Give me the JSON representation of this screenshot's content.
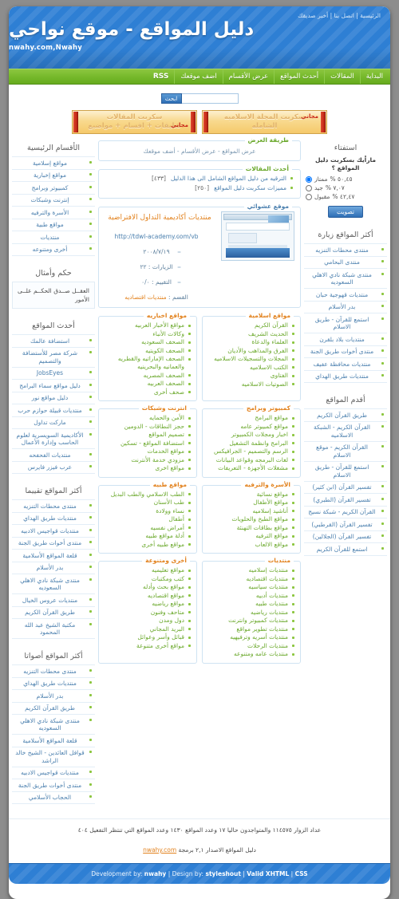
{
  "header": {
    "title": "دليل المواقع - موقع نواحي",
    "subtitle": "nwahy.com,Nwahy",
    "toplinks": [
      "الرئيسية",
      "اتصل بنا",
      "أخبر صديقك"
    ],
    "separator": " | "
  },
  "nav": {
    "items": [
      "البداية",
      "المقالات",
      "أحدث المواقع",
      "عرض الأقسام",
      "اضف موقعك",
      "RSS"
    ]
  },
  "search": {
    "value": "",
    "placeholder": "",
    "button": "ابحث"
  },
  "banners": [
    {
      "line1": "سكربت المجلة الاسلاميه",
      "line2": "الشامله",
      "free": "مجاني"
    },
    {
      "line1": "سكربت المقالات",
      "line2": "تعليقات + اقسام + مواضيع",
      "free": "مجاني"
    }
  ],
  "view_panel": {
    "legend": "طريقة العرض",
    "links": [
      "عرض المواقع",
      "عرض الأقسام",
      "أضف موقعك"
    ],
    "joiner": " - "
  },
  "articles_panel": {
    "legend": "أحدث المقالات",
    "items": [
      {
        "title": "الترقيه من دليل المواقع الشامل الى هذا الدليل",
        "count": "[٤٣٣]"
      },
      {
        "title": "مميزات سكربت دليل المواقع",
        "count": "[٢٥٠]"
      }
    ]
  },
  "random_panel": {
    "legend": "موقع عشوائي",
    "title": "منتديات أكاديمية التداول الافتراضية",
    "url": "http://tdwl-academy.com/vb",
    "date": "٢٠٠٨/٧/١٩",
    "visits_label": "الزيارات",
    "visits": "٢٢",
    "rating_label": "التقييم",
    "rating": "٠/٠",
    "cat_label": "القسم",
    "category": "منتديات اقتصاديه"
  },
  "categories": [
    {
      "legend": "مواقع اسلامية",
      "items": [
        "القرآن الكريم",
        "الحديث الشريف",
        "العلماء والدعاة",
        "الفرق والمذاهب والأديان",
        "المجلات والتسجيلات الاسلاميه",
        "الكتب الاسلاميه",
        "الفتاوى",
        "الصوتيات الاسلاميه"
      ]
    },
    {
      "legend": "مواقع اخباريه",
      "items": [
        "مواقع الأخبار العربيه",
        "وكالات الأنباء",
        "الصحف السعوديه",
        "الصحف الكويتيه",
        "الصحف الإماراتيه والقطريه والعمانيه والبحرينيه",
        "الصحف المصريه",
        "الصحف العربيه",
        "صحف أخرى"
      ]
    },
    {
      "legend": "كمبيوتر وبرامج",
      "items": [
        "مواقع البرامج",
        "مواقع كمبيوتر عامه",
        "اخبار ومجلات الكمبيوتر",
        "البرامج وانظمة التشغيل",
        "الرسم والتصميم - الجرافيكس",
        "لغات البرمجه وقواعد البيانات",
        "مشغلات الأجهزة - التعريفات"
      ]
    },
    {
      "legend": "انترنت وشبكات",
      "items": [
        "الأمن والحمايه",
        "حجز النطاقات - الدومين",
        "تصميم المواقع",
        "استضافة المواقع - تسكين",
        "مواقع الخدمات",
        "مزودي خدمة الأنترنت",
        "مواقع اخرى"
      ]
    },
    {
      "legend": "الأسرة والترفيه",
      "items": [
        "مواقع نسائية",
        "مواقع الأطفال",
        "أناشيد إسلاميه",
        "مواقع الطبخ والحلويات",
        "مواقع بطاقات التهنئة",
        "مواقع الترفيه",
        "مواقع الالعاب"
      ]
    },
    {
      "legend": "مواقع طبيه",
      "items": [
        "الطب الاسلامي والطب البديل",
        "طب الأسنان",
        "نساء وولادة",
        "أطفال",
        "أمراض نفسيه",
        "أدلة مواقع طبيه",
        "مواقع طبيه أخرى"
      ]
    },
    {
      "legend": "منتديات",
      "items": [
        "منتديات إسلاميه",
        "منتديات اقتصاديه",
        "منتديات سياسيه",
        "منتديات أدبيه",
        "منتديات طبيه",
        "منتديات رياضيه",
        "منتديات كمبيوتر وانترنت",
        "منتديات تطوير مواقع",
        "منتديات أسريه وترفيهيه",
        "منتديات الرحلات",
        "منتديات عامه ومتنوعه"
      ]
    },
    {
      "legend": "أخرى ومتنوعة",
      "items": [
        "مواقع تعليميه",
        "كتب ومكتبات",
        "مواقع بحث وأدله",
        "مواقع اقتصاديه",
        "مواقع رياضيه",
        "متاحف وفنون",
        "دول ومدن",
        "البريد المجاني",
        "قبائل وأسر وعوائل",
        "مواقع أخرى متنوعة"
      ]
    }
  ],
  "sidebar_right": {
    "main_cats": {
      "title": "الأقسام الرئيسية",
      "items": [
        "مواقع إسلامية",
        "مواقع إخبارية",
        "كمبيوتر وبرامج",
        "إنترنت وشبكات",
        "الأسرة والترفيه",
        "مواقع طبية",
        "منتديات",
        "أخرى ومتنوعه"
      ]
    },
    "quote": {
      "title": "حكم وأمثال",
      "text": "العقــل صــدق الحكــم علــى الأمور"
    },
    "newest": {
      "title": "أحدث المواقع",
      "items": [
        "استضافة عالمك",
        "شركة مصر للأستضافة والتصميم",
        "JobsEyes",
        "دليل مواقع سماء البرامج",
        "دليل مواقع نور",
        "منتديات قبيلة حوازم حرب",
        "ماركت تداول",
        "الأكاديمية السويسرية لعلوم الحاسب وإدارة الأعمال",
        "منتديات الفحفحه",
        "عرب فيزر فايرس"
      ]
    },
    "top_rated": {
      "title": "أكثر المواقع تقييما",
      "items": [
        "منتدى محطات التنزيه",
        "منتديات طريق الهداي",
        "منتديات قواجيس الادبيه",
        "منتدى أخوات طريق الجنة",
        "قلعة المواقع الأسلامية",
        "بدر الأسلام",
        "منتدى شبكة نادي الاهلي السعوديه",
        "منتديات عروس الخيال",
        "طريق القرآن الكريم",
        "مكتبة الشيخ عبد الله المحمود"
      ]
    },
    "top_voted": {
      "title": "أكثر المواقع أصواتا",
      "items": [
        "منتدى محطات التنزيه",
        "منتديات طريق الهداي",
        "بدر الأسلام",
        "طريق القرآن الكريم",
        "منتدى شبكة نادي الاهلي السعوديه",
        "قلعة المواقع الأسلامية",
        "قوافل العائدين - الشيخ خالد الراشد",
        "منتديات قواجيس الادبيه",
        "منتدى أخوات طريق الجنة",
        "الحجاب الأسلامي"
      ]
    }
  },
  "sidebar_left": {
    "poll": {
      "title": "استفتاء",
      "question": "ماراْيك بسكربت دليل المواقع ؟",
      "options": [
        {
          "label": "ممتاز",
          "percent": "٥٠,٤٥ %",
          "checked": true
        },
        {
          "label": "جيد",
          "percent": "٧,٠٧ %",
          "checked": false
        },
        {
          "label": "مقبول",
          "percent": "٤٢,٤٧ %",
          "checked": false
        }
      ],
      "button": "تصويت"
    },
    "most_visited": {
      "title": "أكثر المواقع زيارة",
      "items": [
        "منتدى محطات التنزيه",
        "منتدى البحامي",
        "منتدى شبكة نادي الاهلي السعوديه",
        "منتديات قهوجية حبان",
        "بدر الأسلام",
        "استمع للقرآن - طريق الاسلام",
        "منتديات بلاد بلقرن",
        "منتدى أخوات طريق الجنة",
        "منتديات محافظة عفيف",
        "منتديات طريق الهداي"
      ]
    },
    "oldest": {
      "title": "أقدم المواقع",
      "items": [
        "طريق القرآن الكريم",
        "القرآن الكريم - الشبكة الاسلاميه",
        "القرآن الكريم - موقع الاسلام",
        "استمع للقرآن - طريق الاسلام",
        "تفسير القرآن (ابن كثير)",
        "تفسير القرآن (الطبري)",
        "القرآن الكريم - شبكة نسيج",
        "تفسير القرآن (القرطبي)",
        "تفسير القرآن (الجلالين)",
        "استمع للقرآن الكريم"
      ]
    }
  },
  "footer": {
    "stats": "عداد الزوار ١١٤٥٧٥ والمتواجدون حاليا ١٧ وعدد المواقع ١٤٣٠ وعدد المواقع التي تنتظر التفعيل ٤٠٤",
    "credit_pre": "دليل المواقع الاصدار ٢,١ برمجة ",
    "credit_link": "nwahy.com",
    "dev_label": "Development by:",
    "dev_name": "nwahy",
    "design_label": "Design by:",
    "design_name": "styleshout",
    "valid_xhtml": "Valid XHTML",
    "valid_css": "CSS",
    "sep": " | "
  }
}
